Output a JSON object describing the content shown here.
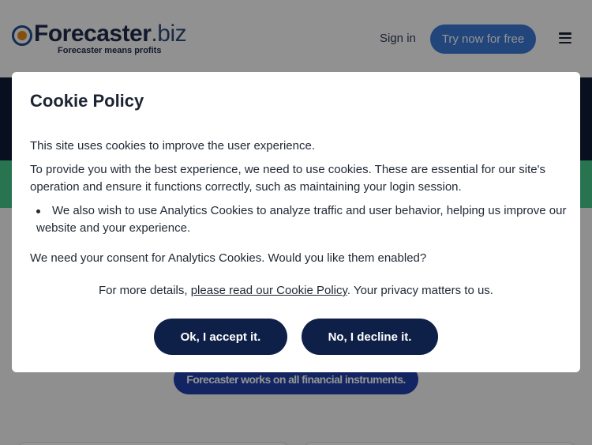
{
  "header": {
    "logo_word": "Forecaster",
    "logo_suffix": ".biz",
    "logo_tagline": "Forecaster means profits",
    "sign_in": "Sign in",
    "try_button": "Try now for free"
  },
  "page": {
    "works_pill": "Forecaster works on all financial instruments."
  },
  "cookie_modal": {
    "title": "Cookie Policy",
    "intro": "This site uses cookies to improve the user experience.",
    "essential": "To provide you with the best experience, we need to use cookies. These are essential for our site's operation and ensure it functions correctly, such as maintaining your login session.",
    "analytics_bullet": "We also wish to use Analytics Cookies to analyze traffic and user behavior, helping us improve our website and your experience.",
    "consent_question": "We need your consent for Analytics Cookies. Would you like them enabled?",
    "details_prefix": "For more details, ",
    "details_link": "please read our Cookie Policy",
    "details_suffix": ". Your privacy matters to us.",
    "accept_button": "Ok, I accept it.",
    "decline_button": "No, I decline it."
  },
  "colors": {
    "accent_blue": "#3b78d4",
    "button_navy": "#0f2048",
    "band_green": "#45c98a",
    "band_dark": "#0e1b35"
  }
}
